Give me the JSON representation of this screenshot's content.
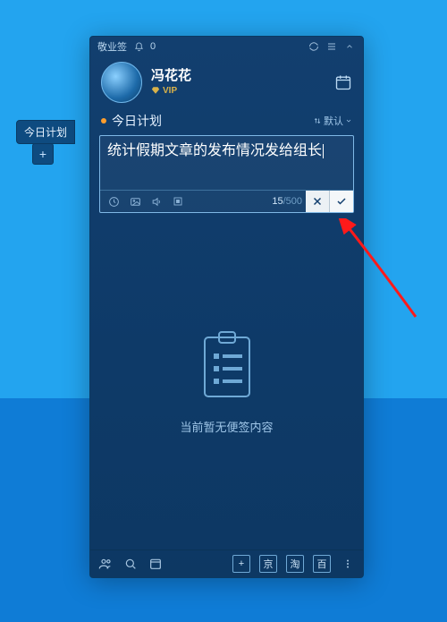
{
  "titlebar": {
    "app_name": "敬业签",
    "badge_count": "0"
  },
  "side": {
    "tab_label": "今日计划",
    "add_label": "+"
  },
  "user": {
    "name": "冯花花",
    "vip_label": "VIP"
  },
  "section": {
    "title": "今日计划",
    "sort_label": "默认"
  },
  "editor": {
    "text": "统计假期文章的发布情况发给组长",
    "count_current": "15",
    "count_max": "/500"
  },
  "empty": {
    "message": "当前暂无便签内容"
  },
  "footer": {
    "btn1": "+",
    "btn2": "京",
    "btn3": "淘",
    "btn4": "百"
  }
}
